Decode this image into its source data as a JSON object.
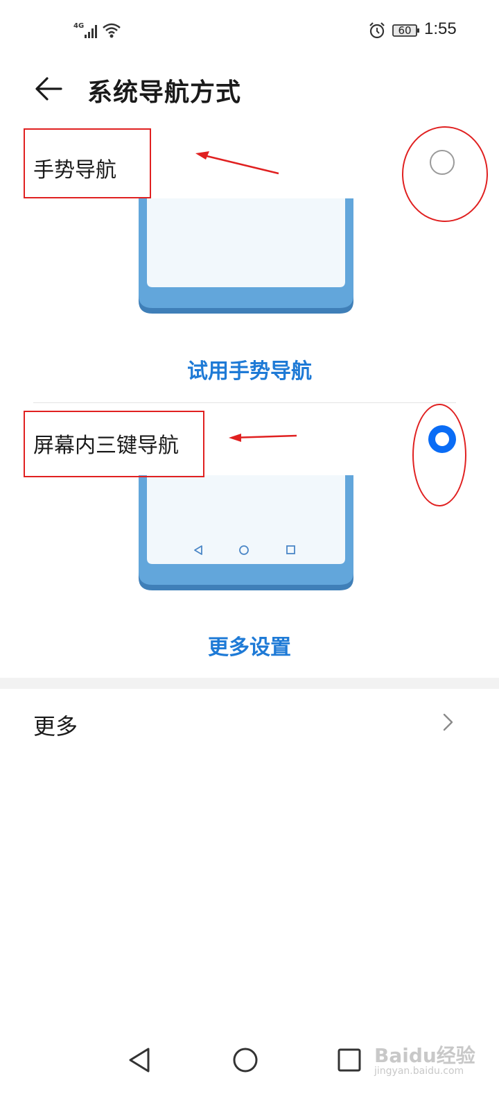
{
  "status_bar": {
    "network": "4G",
    "battery": "60",
    "time": "1:55",
    "icons": [
      "signal-icon",
      "wifi-icon",
      "alarm-icon",
      "battery-icon"
    ]
  },
  "header": {
    "title": "系统导航方式",
    "back_icon": "arrow-left-icon"
  },
  "options": [
    {
      "label": "手势导航",
      "selected": false,
      "link": "试用手势导航"
    },
    {
      "label": "屏幕内三键导航",
      "selected": true,
      "link": "更多设置"
    }
  ],
  "more": {
    "label": "更多",
    "icon": "chevron-right-icon"
  },
  "nav_bar": {
    "icons": [
      "back-triangle-icon",
      "home-circle-icon",
      "recents-square-icon"
    ]
  },
  "watermark": {
    "text": "Baidu经验",
    "sub": "jingyan.baidu.com"
  },
  "colors": {
    "accent": "#0a6cf5",
    "link": "#1e7ad6",
    "annotation": "#e02020",
    "phone_frame": "#62a6db",
    "phone_screen": "#f2f8fc"
  }
}
